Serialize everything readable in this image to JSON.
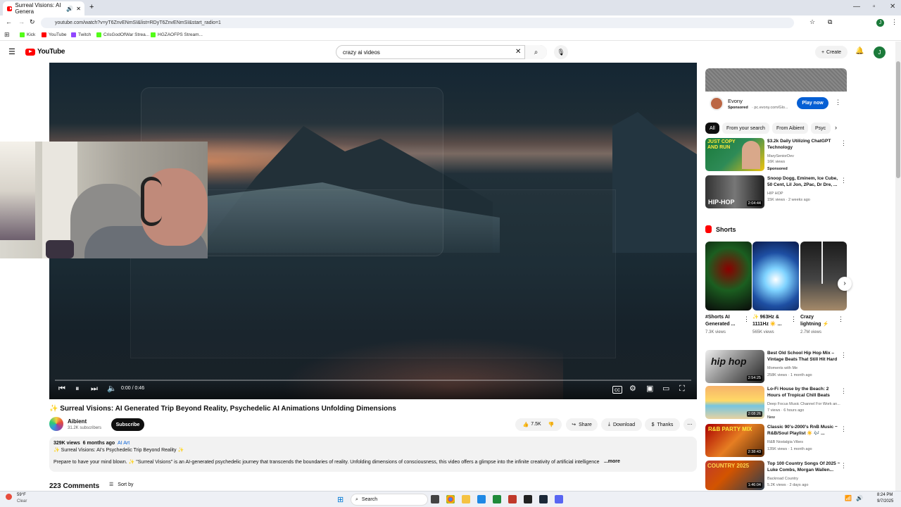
{
  "browser": {
    "tab_title": "Surreal Visions: AI Genera",
    "url": "youtube.com/watch?v=yT6ZnvENmSI&list=RDyT6ZnvENmSI&start_radio=1",
    "bookmarks": [
      {
        "label": "Kick",
        "color": "#53fc18"
      },
      {
        "label": "YouTube",
        "color": "#ff0000"
      },
      {
        "label": "Twitch",
        "color": "#9146ff"
      },
      {
        "label": "CrisGodOfWar Strea...",
        "color": "#53fc18"
      },
      {
        "label": "HGZAOFPS Stream...",
        "color": "#53fc18"
      }
    ]
  },
  "youtube": {
    "logo_text": "YouTube",
    "search_value": "crazy ai videos",
    "create_label": "Create",
    "avatar_letter": "J"
  },
  "player": {
    "time": "0:00 / 0:46",
    "progress": 0
  },
  "video": {
    "sparkle": "✨",
    "title": "Surreal Visions: AI Generated Trip Beyond Reality, Psychedelic AI Animations Unfolding Dimensions",
    "channel": "Aibient",
    "subscribers": "31.2K subscribers",
    "subscribe_label": "Subscribe",
    "likes": "7.5K",
    "share_label": "Share",
    "download_label": "Download",
    "thanks_label": "Thanks",
    "views": "329K views",
    "age": "6 months ago",
    "tag": "AI Art",
    "desc_line1": "✨ Surreal Visions: AI's Psychedelic Trip Beyond Reality ✨",
    "desc_line2": "Prepare to have your mind blown. ✨ \"Surreal Visions\" is an AI-generated psychedelic journey that transcends the boundaries of reality.  Unfolding dimensions of consciousness, this video offers a glimpse into the infinite creativity of artificial intelligence",
    "more_label": "...more",
    "comments": "223 Comments",
    "sort_label": "Sort by"
  },
  "sidebar": {
    "ad": {
      "name": "Evony",
      "sponsored": "Sponsored",
      "domain": "· pc.evony.com/Glo...",
      "cta": "Play now"
    },
    "chips": [
      "All",
      "From your search",
      "From Aibient",
      "Psyc"
    ],
    "videos": [
      {
        "title": "$3.2k Daily Utilizing ChatGPT Technology",
        "channel": "MarySeniorDev",
        "meta": "16K views",
        "extra": "Sponsored",
        "duration": ""
      },
      {
        "title": "Snoop Dogg, Eminem, Ice Cube, 50 Cent, Lil Jon, 2Pac, Dr Dre, ...",
        "channel": "HIP HOP",
        "meta": "15K views · 2 weeks ago",
        "extra": "",
        "duration": "2:04:44"
      }
    ],
    "shorts_label": "Shorts",
    "shorts": [
      {
        "title": "#Shorts AI Generated ...",
        "views": "7.3K views"
      },
      {
        "title": "✨ 963Hz & 1111Hz ☀️ ...",
        "views": "565K views"
      },
      {
        "title": "Crazy lightning ⚡",
        "views": "2.7M views"
      }
    ],
    "videos2": [
      {
        "title": "Best Old School Hip Hop Mix – Vintage Beats That Still Hit Hard",
        "channel": "Moments with Me",
        "meta": "258K views · 1 month ago",
        "extra": "",
        "duration": "2:54:25"
      },
      {
        "title": "Lo-Fi House by the Beach: 2 Hours of Tropical Chill Beats",
        "channel": "Deep Focus Music Channel For Work an...",
        "meta": "7 views · 6 hours ago",
        "extra": "New",
        "duration": "2:08:26"
      },
      {
        "title": "Classic 90's-2000's RnB Music ~ R&B/Soul Playlist ☀️ 🎶 ...",
        "channel": "R&B Nostalgia Vibes",
        "meta": "135K views · 1 month ago",
        "extra": "",
        "duration": "2:38:43"
      },
      {
        "title": "Top 100 Country Songs Of 2025 ~ Luke Combs, Morgan Wallen...",
        "channel": "Backroad Country",
        "meta": "5.2K views · 2 days ago",
        "extra": "",
        "duration": "1:46:04"
      }
    ]
  },
  "taskbar": {
    "weather_temp": "59°F",
    "weather_text": "Clear",
    "search": "Search",
    "time": "8:24 PM",
    "date": "9/7/2025"
  }
}
